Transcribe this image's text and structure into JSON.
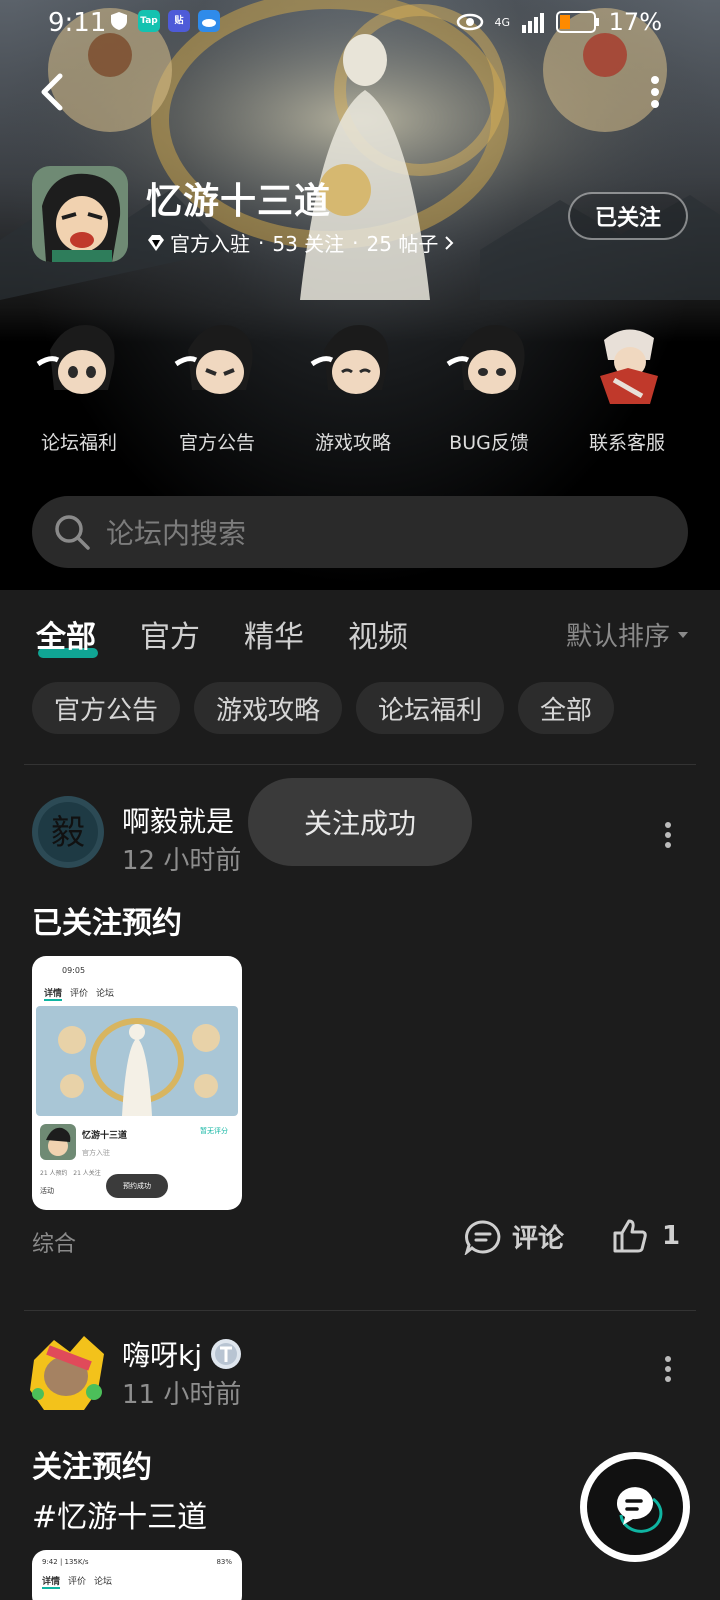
{
  "status_bar": {
    "time": "9:11",
    "net_label": "4G",
    "battery": "17%",
    "icons": [
      "shield-icon",
      "tap-icon",
      "tieba-icon",
      "cloud-icon",
      "eye-icon",
      "signal-icon",
      "battery-icon"
    ]
  },
  "forum": {
    "title": "忆游十三道",
    "official": "官方入驻",
    "follows": "53 关注",
    "posts": "25 帖子",
    "sep": "·",
    "follow_label": "已关注"
  },
  "shortcuts": [
    {
      "label": "论坛福利"
    },
    {
      "label": "官方公告"
    },
    {
      "label": "游戏攻略"
    },
    {
      "label": "BUG反馈"
    },
    {
      "label": "联系客服"
    }
  ],
  "search": {
    "placeholder": "论坛内搜索"
  },
  "tabs": [
    {
      "label": "全部",
      "active": true
    },
    {
      "label": "官方"
    },
    {
      "label": "精华"
    },
    {
      "label": "视频"
    }
  ],
  "sort": {
    "label": "默认排序"
  },
  "chips": [
    {
      "label": "官方公告"
    },
    {
      "label": "游戏攻略"
    },
    {
      "label": "论坛福利"
    },
    {
      "label": "全部"
    }
  ],
  "posts": [
    {
      "author": "啊毅就是",
      "time": "12 小时前",
      "title": "已关注预约",
      "category": "综合",
      "comment_label": "评论",
      "likes": "1",
      "thumb": {
        "status_time": "09:05",
        "tabs": [
          "详情",
          "评价",
          "论坛"
        ],
        "game_name": "忆游十三道",
        "rating": "暂无评分",
        "official": "官方入驻",
        "stats": "21 人预约   21 人关注",
        "activity": "活动",
        "toast": "预约成功"
      }
    },
    {
      "author": "嗨呀kj",
      "time": "11 小时前",
      "title": "关注预约",
      "body": "#忆游十三道",
      "thumb": {
        "status_time": "9:42 | 135K/s",
        "tabs": [
          "详情",
          "评价",
          "论坛"
        ],
        "battery": "83%"
      }
    }
  ],
  "toast": {
    "text": "关注成功"
  },
  "colors": {
    "accent": "#0fb5a2",
    "background": "#1c1c1c",
    "header": "#000000",
    "chip": "#2c2c2c"
  }
}
